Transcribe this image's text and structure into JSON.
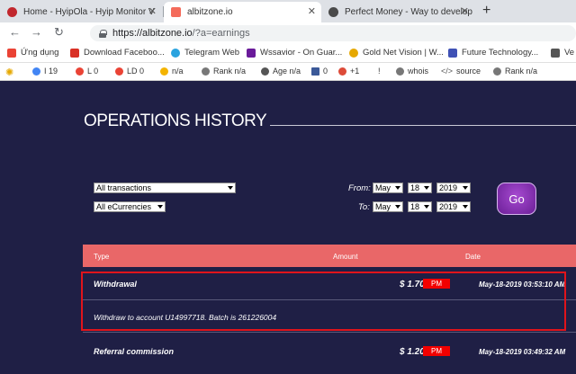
{
  "tabs": [
    {
      "title": "Home - HyipOla - Hyip Monitor V",
      "color": "#c1272d"
    },
    {
      "title": "albitzone.io",
      "color": "#f46b5b"
    },
    {
      "title": "Perfect Money - Way to develop",
      "color": "#4a4a4a"
    }
  ],
  "toolbar": {
    "url_host": "https://albitzone.io",
    "url_path": "/?a=earnings"
  },
  "bookmarks": [
    {
      "label": "Ứng dụng",
      "color": "#ea4335"
    },
    {
      "label": "Download Faceboo...",
      "color": "#d93025"
    },
    {
      "label": "Telegram Web",
      "color": "#2aa3df"
    },
    {
      "label": "Wssavior - On Guar...",
      "color": "#6a1b9a"
    },
    {
      "label": "Gold Net Vision | W...",
      "color": "#e6a800"
    },
    {
      "label": "Future Technology...",
      "color": "#3f51b5"
    },
    {
      "label": "Ve",
      "color": "#555555"
    }
  ],
  "extensions": [
    {
      "label": "I 19"
    },
    {
      "label": "L 0"
    },
    {
      "label": "LD 0"
    },
    {
      "label": "n/a"
    },
    {
      "label": "Rank n/a"
    },
    {
      "label": "Age n/a"
    },
    {
      "label": "0"
    },
    {
      "label": "+1"
    },
    {
      "label": "!"
    },
    {
      "label": "whois"
    },
    {
      "label": "source"
    },
    {
      "label": "Rank n/a"
    }
  ],
  "page": {
    "title": "OPERATIONS HISTORY"
  },
  "filters": {
    "type_value": "All transactions",
    "currency_value": "All eCurrencies",
    "from_label": "From:",
    "to_label": "To:",
    "from": {
      "month": "May",
      "day": "18",
      "year": "2019"
    },
    "to": {
      "month": "May",
      "day": "18",
      "year": "2019"
    },
    "go_label": "Go"
  },
  "table": {
    "headers": [
      "Type",
      "Amount",
      "Date"
    ],
    "rows": [
      {
        "type": "Withdrawal",
        "amount": "$ 1.70",
        "currency": "PM",
        "date": "May-18-2019 03:53:10 AM",
        "note": "Withdraw to account U14997718. Batch is 261226004"
      },
      {
        "type": "Referral commission",
        "amount": "$ 1.20",
        "currency": "PM",
        "date": "May-18-2019 03:49:32 AM"
      }
    ]
  }
}
